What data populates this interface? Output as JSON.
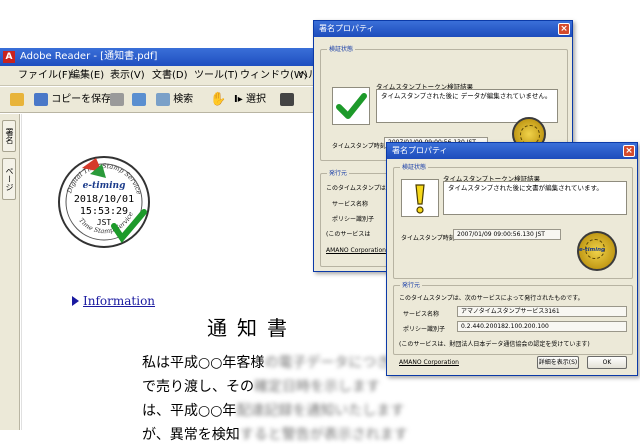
{
  "reader": {
    "window_title": "Adobe Reader - [通知書.pdf]",
    "menu": [
      "ファイル(F)",
      "編集(E)",
      "表示(V)",
      "文書(D)",
      "ツール(T)",
      "ウィンドウ(W)",
      "ヘルプ"
    ],
    "toolbar": {
      "save_copy_label": "コピーを保存",
      "search_label": "検索",
      "select_label": "選択"
    },
    "side_tabs": [
      "署名",
      "ページ"
    ],
    "stamp": {
      "top_arc": "Digital Time Stamp Service",
      "logo": "e-timing",
      "date": "2018/10/01",
      "time": "15:53:29",
      "zone": "JST",
      "bottom_arc": "Time Stamp Service"
    },
    "info_link": "Information",
    "doc_title": "通知書",
    "body_lines": [
      {
        "clear": "私は平成○○年客様",
        "blurred": "の電子データにつきまして"
      },
      {
        "clear": "で売り渡し、その",
        "blurred": "確定日時を示します"
      },
      {
        "clear": "は、平成○○年",
        "blurred": "配達記録を通知いたします"
      },
      {
        "clear": "が、異常を検知",
        "blurred": "すると警告が表示されます"
      }
    ]
  },
  "dialog_valid": {
    "title": "署名プロパティ",
    "group_verify": "検証状態",
    "summary_title": "タイムスタンプトークン検証結果",
    "summary_text": "タイムスタンプされた後に データが編集されていません。",
    "timestamp_label": "タイムスタンプ時刻",
    "timestamp_value": "2007/01/09 09:00:56.130 JST",
    "group_issuer": "発行元",
    "issuer_intro": "このタイムスタンプは、",
    "service_label": "サービス名称",
    "policy_label": "ポリシー識別子",
    "note": "(このサービスは",
    "issuer_name": "AMANO Corporation"
  },
  "dialog_warn": {
    "title": "署名プロパティ",
    "group_verify": "検証状態",
    "summary_title": "タイムスタンプトークン検証結果",
    "summary_text": "タイムスタンプされた後に文書が編集されています。",
    "timestamp_label": "タイムスタンプ時刻",
    "timestamp_value": "2007/01/09 09:00:56.130 JST",
    "group_issuer": "発行元",
    "issuer_intro": "このタイムスタンプは、次のサービスによって発行されたものです。",
    "service_label": "サービス名称",
    "service_value": "アマノタイムスタンプサービス3161",
    "policy_label": "ポリシー識別子",
    "policy_value": "0.2.440.200182.100.200.100",
    "note": "(このサービスは、財団法人日本データ通信協会の認定を受けています)",
    "issuer_name": "AMANO Corporation",
    "details_button": "詳細を表示(S)",
    "ok_button": "OK",
    "seal_logo": "e-timing"
  },
  "colors": {
    "titlebar": "#2a5ccf",
    "link": "#1a1aa0",
    "check_green": "#1d9a2a",
    "warn_yellow": "#f6d81a"
  }
}
